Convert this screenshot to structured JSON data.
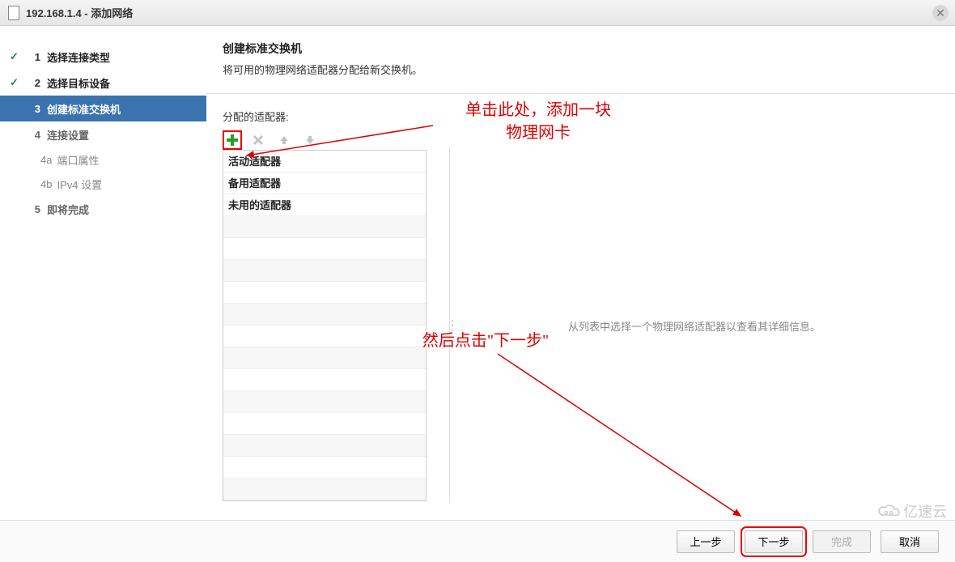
{
  "window": {
    "title": "192.168.1.4 - 添加网络"
  },
  "steps": {
    "s1": {
      "num": "1",
      "label": "选择连接类型"
    },
    "s2": {
      "num": "2",
      "label": "选择目标设备"
    },
    "s3": {
      "num": "3",
      "label": "创建标准交换机"
    },
    "s4": {
      "num": "4",
      "label": "连接设置"
    },
    "s4a": {
      "num": "4a",
      "label": "端口属性"
    },
    "s4b": {
      "num": "4b",
      "label": "IPv4 设置"
    },
    "s5": {
      "num": "5",
      "label": "即将完成"
    }
  },
  "main": {
    "title": "创建标准交换机",
    "subtitle": "将可用的物理网络适配器分配给新交换机。",
    "section_label": "分配的适配器:",
    "detail_placeholder": "从列表中选择一个物理网络适配器以查看其详细信息。",
    "adapter_headers": {
      "active": "活动适配器",
      "standby": "备用适配器",
      "unused": "未用的适配器"
    }
  },
  "annotations": {
    "a1_line1": "单击此处，添加一块",
    "a1_line2": "物理网卡",
    "a2": "然后点击\"下一步\""
  },
  "footer": {
    "back": "上一步",
    "next": "下一步",
    "finish": "完成",
    "cancel": "取消"
  },
  "watermark": "亿速云",
  "colors": {
    "accent": "#3b73af",
    "annotation": "#d00000",
    "check": "#1e8e3e"
  }
}
